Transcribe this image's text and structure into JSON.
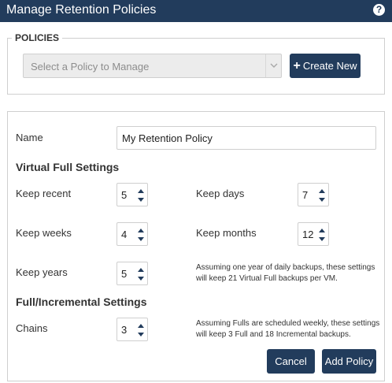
{
  "window": {
    "title": "Manage Retention Policies",
    "help_icon": "question-circle-icon",
    "help_glyph": "?"
  },
  "policies": {
    "legend": "POLICIES",
    "select_placeholder": "Select a Policy to Manage",
    "create_button": "Create New",
    "create_plus": "+"
  },
  "form": {
    "name_label": "Name",
    "name_value": "My Retention Policy",
    "virtual_full_heading": "Virtual Full Settings",
    "keep_recent": {
      "label": "Keep recent",
      "value": "5"
    },
    "keep_days": {
      "label": "Keep days",
      "value": "7"
    },
    "keep_weeks": {
      "label": "Keep weeks",
      "value": "4"
    },
    "keep_months": {
      "label": "Keep months",
      "value": "12"
    },
    "keep_years": {
      "label": "Keep years",
      "value": "5"
    },
    "virtual_note_line1": "Assuming one year of daily backups, these settings",
    "virtual_note_line2": "will keep 21 Virtual Full backups per VM.",
    "full_incremental_heading": "Full/Incremental Settings",
    "chains": {
      "label": "Chains",
      "value": "3"
    },
    "chains_note_line1": "Assuming Fulls are scheduled weekly, these settings",
    "chains_note_line2": "will keep 3 Full and 18 Incremental backups.",
    "cancel_button": "Cancel",
    "add_button": "Add Policy"
  },
  "colors": {
    "navy": "#223c5c",
    "border": "#cfcfcf",
    "disabled_bg": "#ececec"
  }
}
